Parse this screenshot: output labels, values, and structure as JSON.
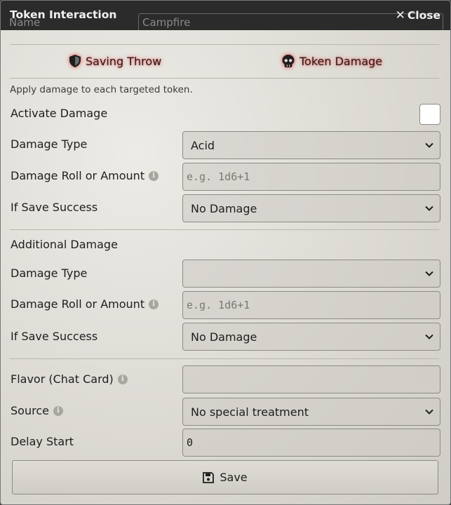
{
  "window": {
    "title": "Token Interaction",
    "close_label": "Close"
  },
  "background": {
    "name_label": "Name",
    "name_value": "Campfire"
  },
  "tabs": [
    {
      "label": "Saving Throw",
      "icon": "shield-icon"
    },
    {
      "label": "Token Damage",
      "icon": "skull-icon"
    }
  ],
  "hint": "Apply damage to each targeted token.",
  "activate": {
    "label": "Activate Damage",
    "checked": false
  },
  "primary": {
    "damage_type_label": "Damage Type",
    "damage_type_value": "Acid",
    "roll_label": "Damage Roll or Amount",
    "roll_placeholder": "e.g. 1d6+1",
    "save_label": "If Save Success",
    "save_value": "No Damage"
  },
  "additional": {
    "heading": "Additional Damage",
    "damage_type_label": "Damage Type",
    "damage_type_value": "",
    "roll_label": "Damage Roll or Amount",
    "roll_placeholder": "e.g. 1d6+1",
    "save_label": "If Save Success",
    "save_value": "No Damage"
  },
  "misc": {
    "flavor_label": "Flavor (Chat Card)",
    "flavor_value": "",
    "source_label": "Source",
    "source_value": "No special treatment",
    "delay_label": "Delay Start",
    "delay_value": "0"
  },
  "save_button": "Save",
  "colors": {
    "titlebar": "#2b2b2b",
    "tab_glow": "#ff0000"
  }
}
